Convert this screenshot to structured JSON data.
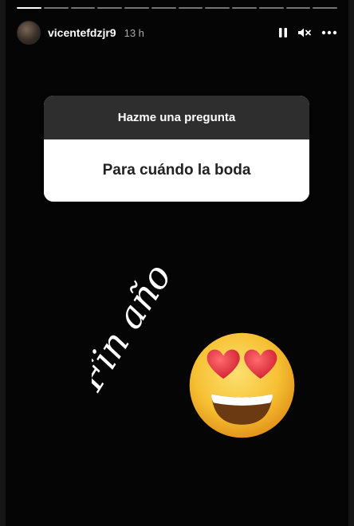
{
  "story": {
    "username": "vicentefdzjr9",
    "time_ago": "13 h",
    "progress": {
      "total_segments": 12,
      "completed_segments": 1
    }
  },
  "controls": {
    "pause_icon": "pause-icon",
    "mute_icon": "muted-speaker-icon",
    "more_icon": "more-horizontal-icon"
  },
  "question_sticker": {
    "header": "Hazme una pregunta",
    "answer": "Para cuándo la boda"
  },
  "overlay": {
    "handwritten_text": "Fin año",
    "emoji": "smiling-face-with-heart-eyes"
  },
  "colors": {
    "background": "#050505",
    "card_header": "#2e2e2e",
    "card_body": "#ffffff",
    "emoji_face": "#f7c236",
    "heart": "#e8303c"
  }
}
